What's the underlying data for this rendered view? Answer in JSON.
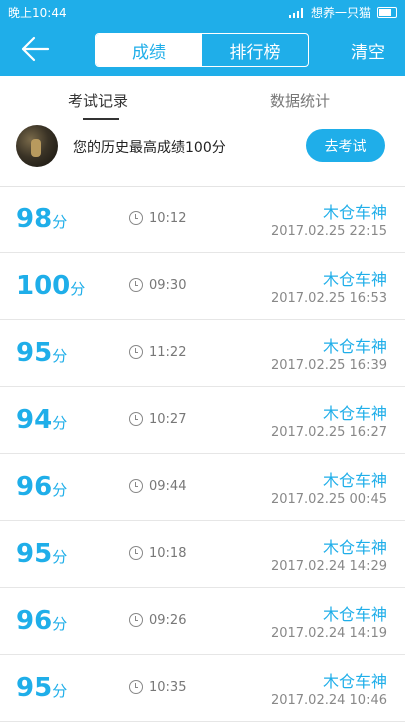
{
  "status": {
    "time": "晚上10:44",
    "carrier": "想养一只猫"
  },
  "header": {
    "segments": [
      "成绩",
      "排行榜"
    ],
    "clear_label": "清空"
  },
  "tabs": [
    "考试记录",
    "数据统计"
  ],
  "summary": {
    "best_text": "您的历史最高成绩100分",
    "exam_button": "去考试"
  },
  "records": [
    {
      "score": "98",
      "unit": "分",
      "duration": "10:12",
      "name": "木仓车神",
      "date": "2017.02.25  22:15"
    },
    {
      "score": "100",
      "unit": "分",
      "duration": "09:30",
      "name": "木仓车神",
      "date": "2017.02.25  16:53"
    },
    {
      "score": "95",
      "unit": "分",
      "duration": "11:22",
      "name": "木仓车神",
      "date": "2017.02.25  16:39"
    },
    {
      "score": "94",
      "unit": "分",
      "duration": "10:27",
      "name": "木仓车神",
      "date": "2017.02.25  16:27"
    },
    {
      "score": "96",
      "unit": "分",
      "duration": "09:44",
      "name": "木仓车神",
      "date": "2017.02.25  00:45"
    },
    {
      "score": "95",
      "unit": "分",
      "duration": "10:18",
      "name": "木仓车神",
      "date": "2017.02.24  14:29"
    },
    {
      "score": "96",
      "unit": "分",
      "duration": "09:26",
      "name": "木仓车神",
      "date": "2017.02.24  14:19"
    },
    {
      "score": "95",
      "unit": "分",
      "duration": "10:35",
      "name": "木仓车神",
      "date": "2017.02.24  10:46"
    }
  ]
}
